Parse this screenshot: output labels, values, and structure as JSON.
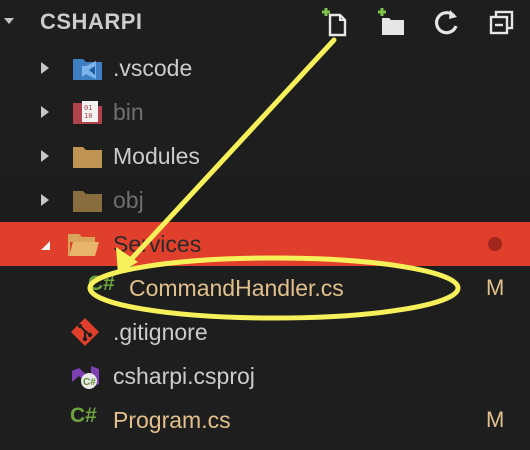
{
  "explorer": {
    "project_name": "CSHARPI",
    "toolbar": {
      "new_file_icon": "new-file-icon",
      "new_folder_icon": "new-folder-icon",
      "refresh_icon": "refresh-icon",
      "collapse_icon": "collapse-all-icon"
    },
    "items": [
      {
        "label": ".vscode",
        "type": "folder",
        "icon": "vscode-folder-icon"
      },
      {
        "label": "bin",
        "type": "folder",
        "icon": "binary-folder-icon"
      },
      {
        "label": "Modules",
        "type": "folder",
        "icon": "folder-icon"
      },
      {
        "label": "obj",
        "type": "folder",
        "icon": "folder-icon"
      },
      {
        "label": "Services",
        "type": "folder",
        "state": "expanded",
        "selected": true,
        "icon": "open-folder-icon"
      },
      {
        "label": "CommandHandler.cs",
        "type": "file",
        "decoration": "M",
        "icon": "csharp-icon"
      },
      {
        "label": ".gitignore",
        "type": "file",
        "icon": "git-icon"
      },
      {
        "label": "csharpi.csproj",
        "type": "file",
        "icon": "csproj-icon"
      },
      {
        "label": "Program.cs",
        "type": "file",
        "decoration": "M",
        "icon": "csharp-icon"
      }
    ]
  },
  "colors": {
    "background": "#1e1e1e",
    "selection": "#e0402b",
    "modified": "#e2c08d",
    "annotation": "#f6f05a",
    "folder": "#c09553"
  }
}
